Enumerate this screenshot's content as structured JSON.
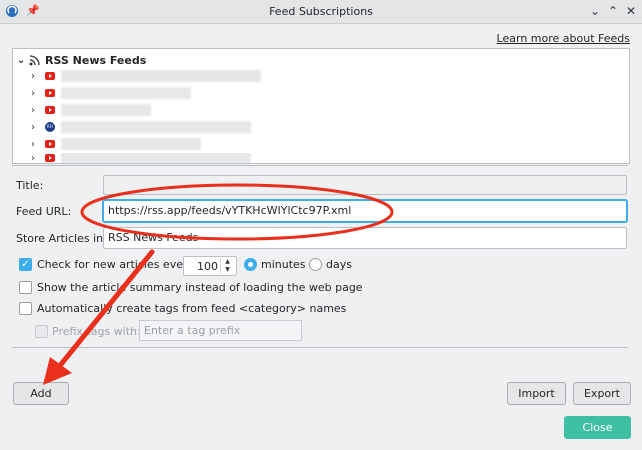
{
  "window": {
    "title": "Feed Subscriptions",
    "controls": [
      "chevron-down-icon",
      "chevron-up-icon",
      "close-icon"
    ]
  },
  "learn_more": "Learn more about Feeds",
  "tree": {
    "root_label": "RSS News Feeds",
    "items": [
      {
        "icon": "youtube-icon"
      },
      {
        "icon": "youtube-icon"
      },
      {
        "icon": "youtube-icon"
      },
      {
        "icon": "rfi-icon",
        "badge_text": "RFI"
      },
      {
        "icon": "youtube-icon"
      },
      {
        "icon": "youtube-icon"
      }
    ]
  },
  "form": {
    "title_label": "Title:",
    "title_value": "",
    "feed_url_label": "Feed URL:",
    "feed_url_value": "https://rss.app/feeds/vYTKHcWIYlCtc97P.xml",
    "store_label": "Store Articles in:",
    "store_value": "RSS News Feeds",
    "check_label": "Check for new articles every",
    "check_checked": true,
    "interval_value": "100",
    "minutes_label": "minutes",
    "days_label": "days",
    "minutes_selected": true,
    "summary_label": "Show the article summary instead of loading the web page",
    "summary_checked": false,
    "autotag_label": "Automatically create tags from feed <category> names",
    "autotag_checked": false,
    "prefix_label": "Prefix tags with:",
    "prefix_placeholder": "Enter a tag prefix",
    "prefix_checked": false
  },
  "buttons": {
    "add": "Add",
    "import": "Import",
    "export": "Export",
    "close": "Close"
  },
  "colors": {
    "accent": "#3daee9",
    "close_button": "#3fc0a3",
    "annotation": "#e8301c"
  }
}
